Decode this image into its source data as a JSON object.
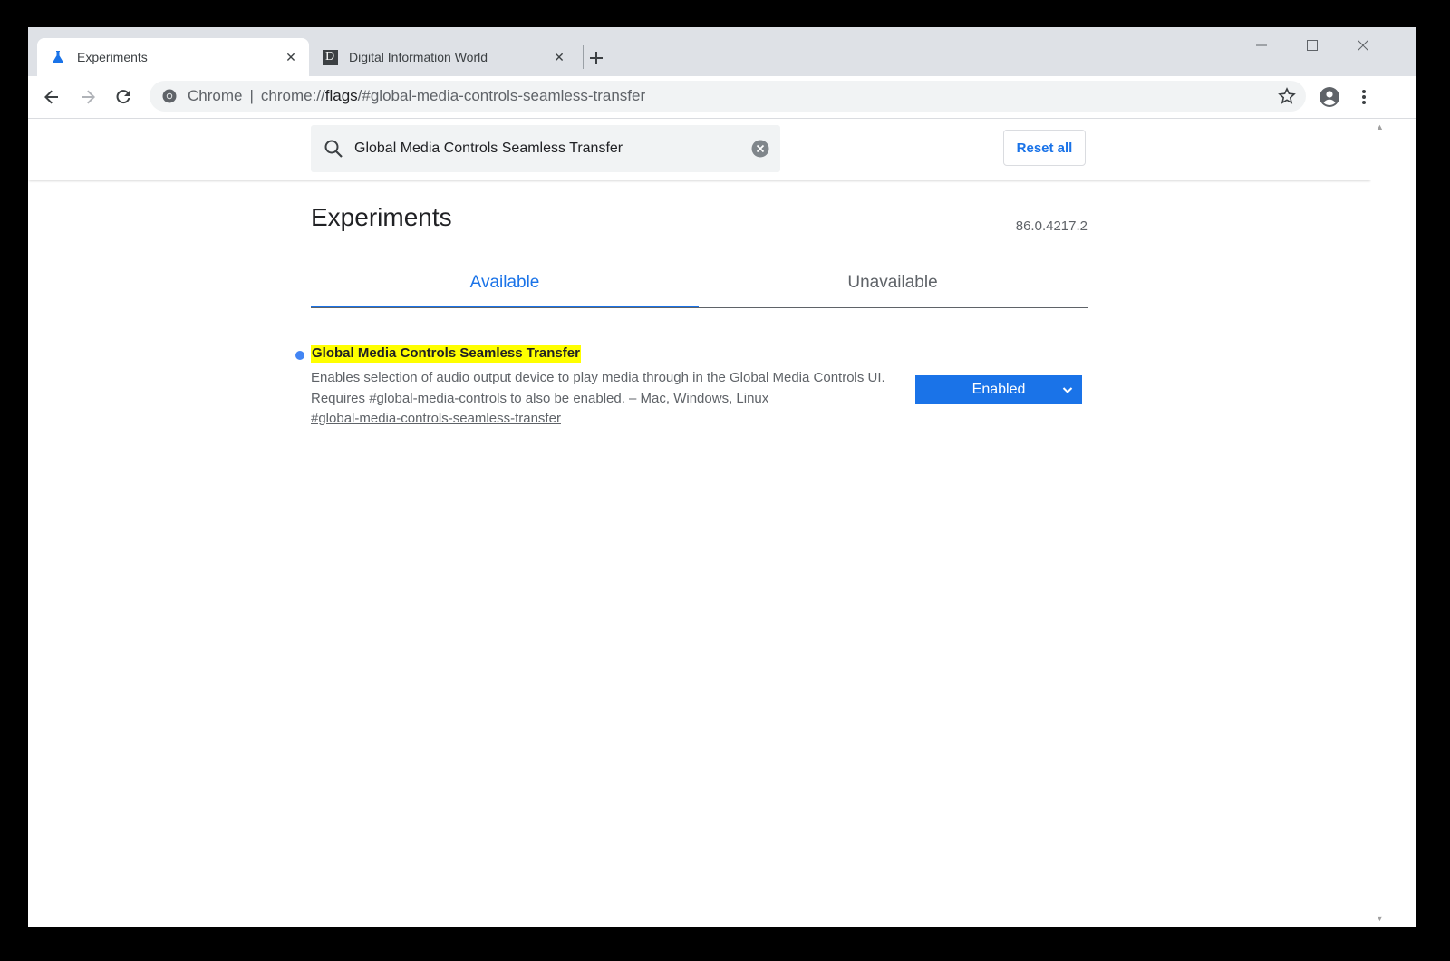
{
  "browser": {
    "tabs": [
      {
        "title": "Experiments",
        "favicon": "flask-icon",
        "active": true
      },
      {
        "title": "Digital Information World",
        "favicon": "site-d-icon",
        "favicon_letter": "D",
        "active": false
      }
    ],
    "omnibox": {
      "chip": "Chrome",
      "separator": "|",
      "url_scheme": "chrome://",
      "url_host": "flags",
      "url_path": "/#global-media-controls-seamless-transfer"
    }
  },
  "page": {
    "search": {
      "value": "Global Media Controls Seamless Transfer"
    },
    "reset_label": "Reset all",
    "title": "Experiments",
    "version": "86.0.4217.2",
    "tabs": [
      {
        "label": "Available",
        "selected": true
      },
      {
        "label": "Unavailable",
        "selected": false
      }
    ],
    "experiment": {
      "name": "Global Media Controls Seamless Transfer",
      "description": "Enables selection of audio output device to play media through in the Global Media Controls UI. Requires #global-media-controls to also be enabled. – Mac, Windows, Linux",
      "link": "#global-media-controls-seamless-transfer",
      "state": "Enabled"
    }
  },
  "colors": {
    "accent": "#1a73e8",
    "highlight": "#ffff00",
    "tabstrip": "#dee1e6"
  }
}
